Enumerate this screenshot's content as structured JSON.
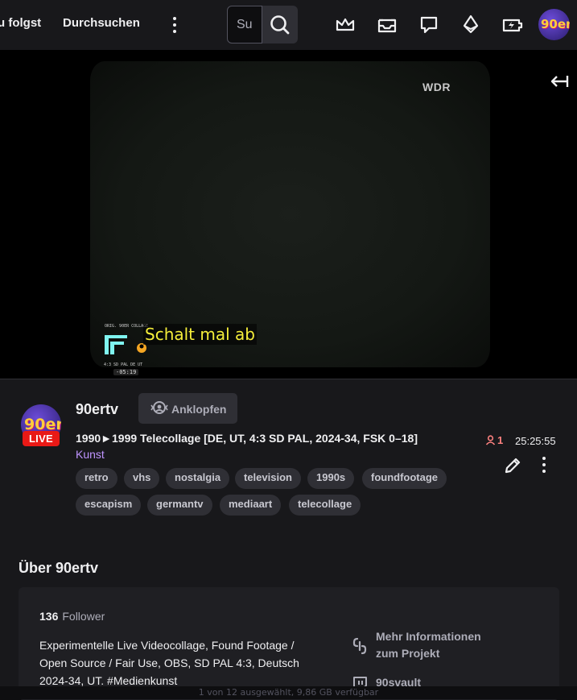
{
  "nav": {
    "following": "u folgst",
    "browse": "Durchsuchen",
    "search_placeholder": "Su"
  },
  "player": {
    "broadcaster_mark": "WDR",
    "subtitle": "Schalt mal ab",
    "overlay_caption": "ORIG. 90ER COLLAGE",
    "overlay_meta": "4:3 SD PAL DE UT",
    "overlay_time": "-05:19"
  },
  "channel": {
    "name": "90ertv",
    "avatar_text": "90er",
    "live_label": "LIVE",
    "knock_label": "Anklopfen",
    "stream_title": "1990►1999 Telecollage [DE, UT, 4:3 SD PAL, 2024-34, FSK 0–18]",
    "category": "Kunst",
    "viewer_count": "1",
    "uptime": "25:25:55",
    "tags": [
      "retro",
      "vhs",
      "nostalgia",
      "television",
      "1990s",
      "foundfootage",
      "escapism",
      "germantv",
      "mediaart",
      "telecollage"
    ]
  },
  "about": {
    "title": "Über 90ertv",
    "follower_count": "136",
    "follower_label": "Follower",
    "description": "Experimentelle Live Videocollage, Found Footage / Open Source / Fair Use, OBS, SD PAL 4:3, Deutsch 2024-34, UT. #Medienkunst",
    "link1": "Mehr Informationen zum Projekt",
    "link2": "90svault"
  },
  "statusbar": {
    "text": "1 von 12 ausgewählt, 9,86 GB verfügbar"
  },
  "colors": {
    "accent": "#bf94ff",
    "live": "#e91916",
    "viewers": "#ff8280",
    "subtitle": "#f5ee3a"
  }
}
